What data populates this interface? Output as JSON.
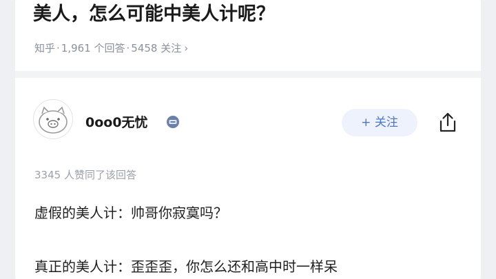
{
  "question": {
    "title": "美人，怎么可能中美人计呢？",
    "meta": {
      "source": "知乎",
      "answers": "1,961 个回答",
      "followers": "5458 关注",
      "sep": "·",
      "chevron": "›"
    }
  },
  "author": {
    "name": "0oo0无忧",
    "follow_label": "+ 关注"
  },
  "answer": {
    "upvote_text": "3345 人赞同了该回答",
    "lines": [
      "虚假的美人计：帅哥你寂寞吗？",
      "真正的美人计：歪歪歪，你怎么还和高中时一样呆"
    ]
  },
  "icons": {
    "avatar": "pig-face-avatar",
    "badge": "vip-badge-icon",
    "share": "share-icon"
  }
}
